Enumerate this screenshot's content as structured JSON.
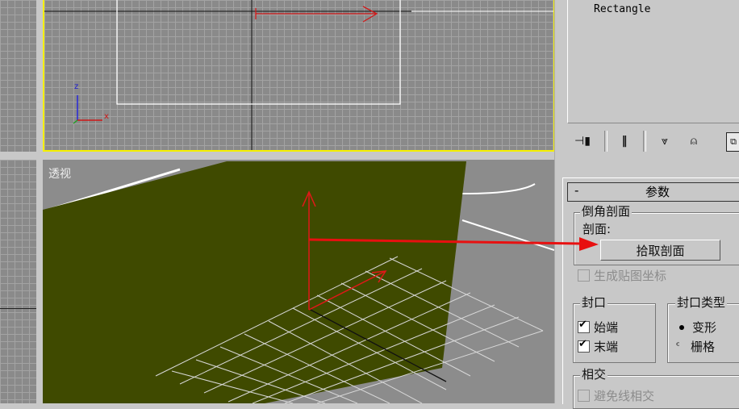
{
  "viewports": {
    "perspective_label": "透视",
    "axis_z": "z",
    "axis_x": "x"
  },
  "modifier_stack": {
    "items": [
      "Rectangle"
    ]
  },
  "toolbar": {
    "icons": [
      "pin-stack-icon",
      "show-end-result-icon",
      "make-unique-icon",
      "remove-modifier-icon",
      "configure-modifier-sets-icon"
    ]
  },
  "rollout": {
    "collapse_symbol": "-",
    "title": "参数",
    "bevel_profile_group": "倒角剖面",
    "profile_label": "剖面:",
    "pick_profile_button": "拾取剖面",
    "generate_mapping": "生成贴图坐标",
    "cap_group": "封口",
    "cap_start": "始端",
    "cap_end": "末端",
    "cap_type_group": "封口类型",
    "cap_morph": "变形",
    "cap_grid": "栅格",
    "intersect_group": "相交",
    "avoid_self_intersect": "避免线相交"
  },
  "colors": {
    "viewport_active_border": "#f5f000",
    "model_fill": "#3f4a00",
    "arrow_red": "#e81010"
  }
}
